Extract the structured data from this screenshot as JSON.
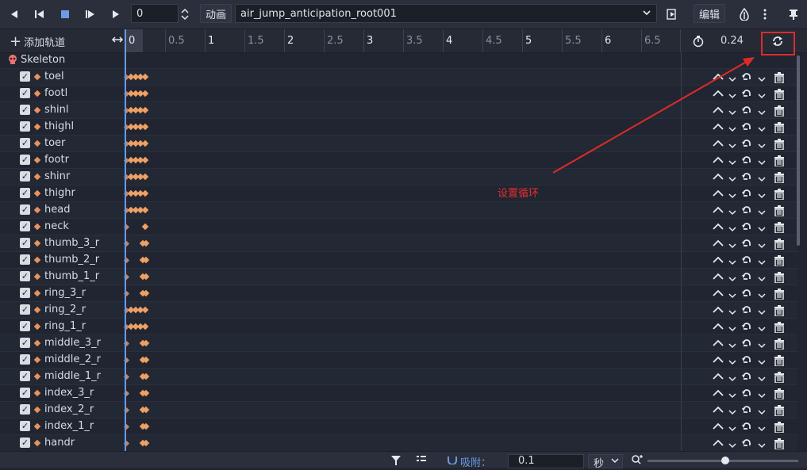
{
  "toolbar": {
    "frame_value": "0",
    "anim_label": "动画",
    "anim_name": "air_jump_anticipation_root001",
    "edit_label": "编辑"
  },
  "ruler": {
    "add_track_label": "添加轨道",
    "ticks": [
      "0",
      "0.5",
      "1",
      "1.5",
      "2",
      "2.5",
      "3",
      "3.5",
      "4",
      "4.5",
      "5",
      "5.5",
      "6",
      "6.5"
    ],
    "length_value": "0.24"
  },
  "root_node": "Skeleton",
  "tracks": [
    {
      "name": "toel",
      "keys": "dense"
    },
    {
      "name": "footl",
      "keys": "dense"
    },
    {
      "name": "shinl",
      "keys": "dense"
    },
    {
      "name": "thighl",
      "keys": "dense"
    },
    {
      "name": "toer",
      "keys": "dense"
    },
    {
      "name": "footr",
      "keys": "dense"
    },
    {
      "name": "shinr",
      "keys": "dense"
    },
    {
      "name": "thighr",
      "keys": "dense"
    },
    {
      "name": "head",
      "keys": "dense"
    },
    {
      "name": "neck",
      "keys": "sparse"
    },
    {
      "name": "thumb_3_r",
      "keys": "pair"
    },
    {
      "name": "thumb_2_r",
      "keys": "pair"
    },
    {
      "name": "thumb_1_r",
      "keys": "pair"
    },
    {
      "name": "ring_3_r",
      "keys": "pair"
    },
    {
      "name": "ring_2_r",
      "keys": "dense"
    },
    {
      "name": "ring_1_r",
      "keys": "dense"
    },
    {
      "name": "middle_3_r",
      "keys": "pair"
    },
    {
      "name": "middle_2_r",
      "keys": "pair"
    },
    {
      "name": "middle_1_r",
      "keys": "pair"
    },
    {
      "name": "index_3_r",
      "keys": "pair"
    },
    {
      "name": "index_2_r",
      "keys": "pair"
    },
    {
      "name": "index_1_r",
      "keys": "pair"
    },
    {
      "name": "handr",
      "keys": "pair"
    }
  ],
  "annotation": "设置循环",
  "bottom": {
    "snap_label": "吸附：",
    "snap_value": "0.1",
    "unit": "秒"
  },
  "colors": {
    "accent": "#6b9ae6",
    "key": "#f0a064",
    "annotation": "#e03030"
  }
}
